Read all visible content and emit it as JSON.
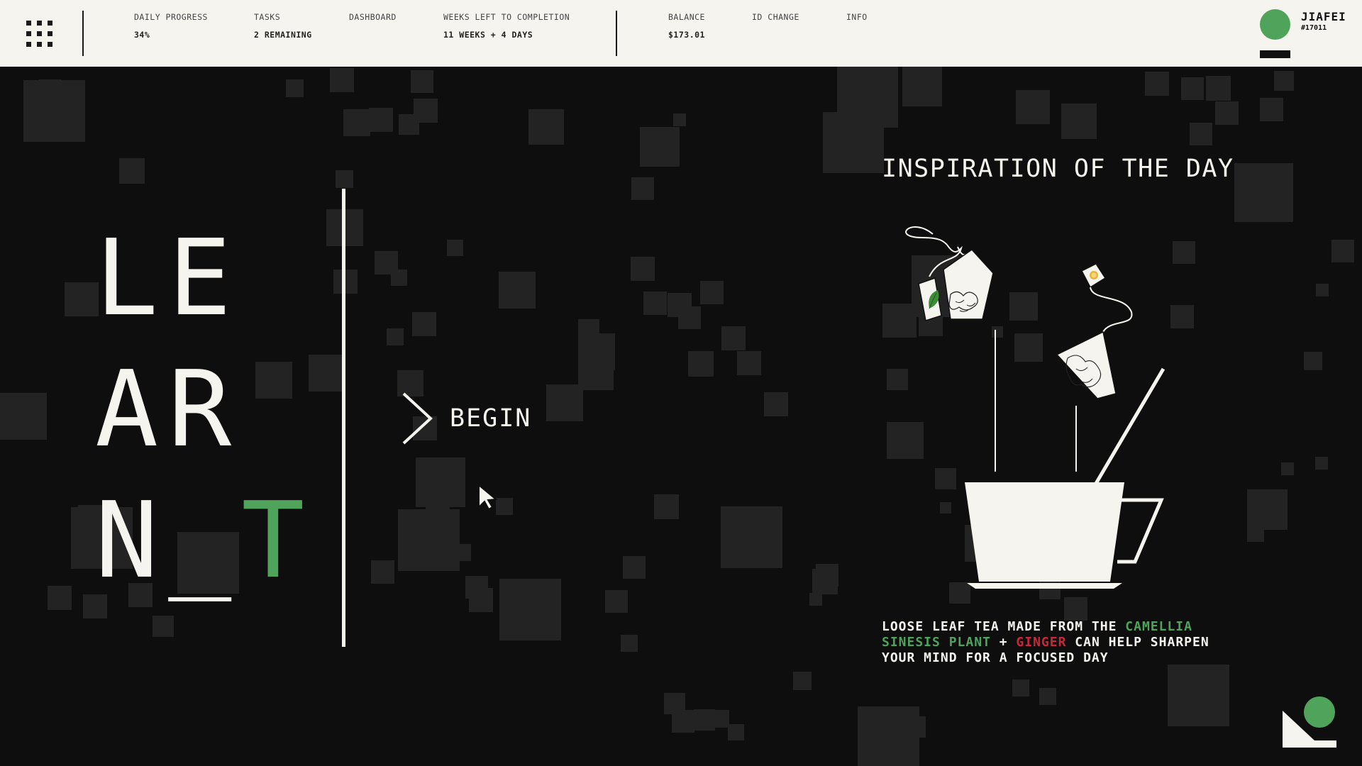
{
  "header": {
    "stats": [
      {
        "label": "DAILY PROGRESS",
        "value": "34%"
      },
      {
        "label": "TASKS",
        "value": "2 REMAINING"
      },
      {
        "label": "DASHBOARD",
        "value": ""
      },
      {
        "label": "WEEKS LEFT TO COMPLETION",
        "value": "11 WEEKS + 4 DAYS"
      }
    ],
    "account": [
      {
        "label": "BALANCE",
        "value": "$173.01"
      },
      {
        "label": "ID CHANGE",
        "value": ""
      },
      {
        "label": "INFO",
        "value": ""
      }
    ],
    "user": {
      "name": "JIAFEI",
      "id": "#17011"
    }
  },
  "hero": {
    "line1": "LE",
    "line2": "AR",
    "line3_prefix": "N_",
    "line3_accent": "T",
    "begin_label": "BEGIN"
  },
  "inspiration": {
    "title": "INSPIRATION OF THE DAY",
    "quote_part1": "LOOSE LEAF TEA MADE FROM THE ",
    "quote_highlight1": "CAMELLIA SINESIS PLANT",
    "quote_part2": " + ",
    "quote_highlight2": "GINGER",
    "quote_part3": " CAN HELP SHARPEN YOUR MIND FOR A FOCUSED DAY"
  },
  "colors": {
    "background": "#0e0e0e",
    "bar": "#f6f4ef",
    "accent_green": "#4fa35a",
    "accent_red": "#c8283a",
    "square": "#232323"
  },
  "icons": [
    "grid-menu-icon",
    "chevron-right-icon",
    "mouse-cursor-icon",
    "tea-illustration",
    "corner-logo-icon"
  ]
}
